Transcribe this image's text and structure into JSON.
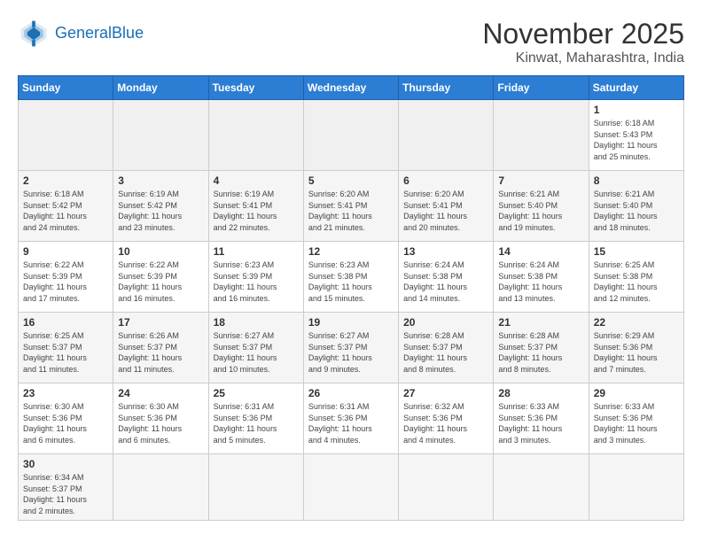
{
  "header": {
    "logo_general": "General",
    "logo_blue": "Blue",
    "month": "November 2025",
    "location": "Kinwat, Maharashtra, India"
  },
  "days_of_week": [
    "Sunday",
    "Monday",
    "Tuesday",
    "Wednesday",
    "Thursday",
    "Friday",
    "Saturday"
  ],
  "weeks": [
    [
      {
        "day": "",
        "info": ""
      },
      {
        "day": "",
        "info": ""
      },
      {
        "day": "",
        "info": ""
      },
      {
        "day": "",
        "info": ""
      },
      {
        "day": "",
        "info": ""
      },
      {
        "day": "",
        "info": ""
      },
      {
        "day": "1",
        "info": "Sunrise: 6:18 AM\nSunset: 5:43 PM\nDaylight: 11 hours\nand 25 minutes."
      }
    ],
    [
      {
        "day": "2",
        "info": "Sunrise: 6:18 AM\nSunset: 5:42 PM\nDaylight: 11 hours\nand 24 minutes."
      },
      {
        "day": "3",
        "info": "Sunrise: 6:19 AM\nSunset: 5:42 PM\nDaylight: 11 hours\nand 23 minutes."
      },
      {
        "day": "4",
        "info": "Sunrise: 6:19 AM\nSunset: 5:41 PM\nDaylight: 11 hours\nand 22 minutes."
      },
      {
        "day": "5",
        "info": "Sunrise: 6:20 AM\nSunset: 5:41 PM\nDaylight: 11 hours\nand 21 minutes."
      },
      {
        "day": "6",
        "info": "Sunrise: 6:20 AM\nSunset: 5:41 PM\nDaylight: 11 hours\nand 20 minutes."
      },
      {
        "day": "7",
        "info": "Sunrise: 6:21 AM\nSunset: 5:40 PM\nDaylight: 11 hours\nand 19 minutes."
      },
      {
        "day": "8",
        "info": "Sunrise: 6:21 AM\nSunset: 5:40 PM\nDaylight: 11 hours\nand 18 minutes."
      }
    ],
    [
      {
        "day": "9",
        "info": "Sunrise: 6:22 AM\nSunset: 5:39 PM\nDaylight: 11 hours\nand 17 minutes."
      },
      {
        "day": "10",
        "info": "Sunrise: 6:22 AM\nSunset: 5:39 PM\nDaylight: 11 hours\nand 16 minutes."
      },
      {
        "day": "11",
        "info": "Sunrise: 6:23 AM\nSunset: 5:39 PM\nDaylight: 11 hours\nand 16 minutes."
      },
      {
        "day": "12",
        "info": "Sunrise: 6:23 AM\nSunset: 5:38 PM\nDaylight: 11 hours\nand 15 minutes."
      },
      {
        "day": "13",
        "info": "Sunrise: 6:24 AM\nSunset: 5:38 PM\nDaylight: 11 hours\nand 14 minutes."
      },
      {
        "day": "14",
        "info": "Sunrise: 6:24 AM\nSunset: 5:38 PM\nDaylight: 11 hours\nand 13 minutes."
      },
      {
        "day": "15",
        "info": "Sunrise: 6:25 AM\nSunset: 5:38 PM\nDaylight: 11 hours\nand 12 minutes."
      }
    ],
    [
      {
        "day": "16",
        "info": "Sunrise: 6:25 AM\nSunset: 5:37 PM\nDaylight: 11 hours\nand 11 minutes."
      },
      {
        "day": "17",
        "info": "Sunrise: 6:26 AM\nSunset: 5:37 PM\nDaylight: 11 hours\nand 11 minutes."
      },
      {
        "day": "18",
        "info": "Sunrise: 6:27 AM\nSunset: 5:37 PM\nDaylight: 11 hours\nand 10 minutes."
      },
      {
        "day": "19",
        "info": "Sunrise: 6:27 AM\nSunset: 5:37 PM\nDaylight: 11 hours\nand 9 minutes."
      },
      {
        "day": "20",
        "info": "Sunrise: 6:28 AM\nSunset: 5:37 PM\nDaylight: 11 hours\nand 8 minutes."
      },
      {
        "day": "21",
        "info": "Sunrise: 6:28 AM\nSunset: 5:37 PM\nDaylight: 11 hours\nand 8 minutes."
      },
      {
        "day": "22",
        "info": "Sunrise: 6:29 AM\nSunset: 5:36 PM\nDaylight: 11 hours\nand 7 minutes."
      }
    ],
    [
      {
        "day": "23",
        "info": "Sunrise: 6:30 AM\nSunset: 5:36 PM\nDaylight: 11 hours\nand 6 minutes."
      },
      {
        "day": "24",
        "info": "Sunrise: 6:30 AM\nSunset: 5:36 PM\nDaylight: 11 hours\nand 6 minutes."
      },
      {
        "day": "25",
        "info": "Sunrise: 6:31 AM\nSunset: 5:36 PM\nDaylight: 11 hours\nand 5 minutes."
      },
      {
        "day": "26",
        "info": "Sunrise: 6:31 AM\nSunset: 5:36 PM\nDaylight: 11 hours\nand 4 minutes."
      },
      {
        "day": "27",
        "info": "Sunrise: 6:32 AM\nSunset: 5:36 PM\nDaylight: 11 hours\nand 4 minutes."
      },
      {
        "day": "28",
        "info": "Sunrise: 6:33 AM\nSunset: 5:36 PM\nDaylight: 11 hours\nand 3 minutes."
      },
      {
        "day": "29",
        "info": "Sunrise: 6:33 AM\nSunset: 5:36 PM\nDaylight: 11 hours\nand 3 minutes."
      }
    ],
    [
      {
        "day": "30",
        "info": "Sunrise: 6:34 AM\nSunset: 5:37 PM\nDaylight: 11 hours\nand 2 minutes."
      },
      {
        "day": "",
        "info": ""
      },
      {
        "day": "",
        "info": ""
      },
      {
        "day": "",
        "info": ""
      },
      {
        "day": "",
        "info": ""
      },
      {
        "day": "",
        "info": ""
      },
      {
        "day": "",
        "info": ""
      }
    ]
  ]
}
